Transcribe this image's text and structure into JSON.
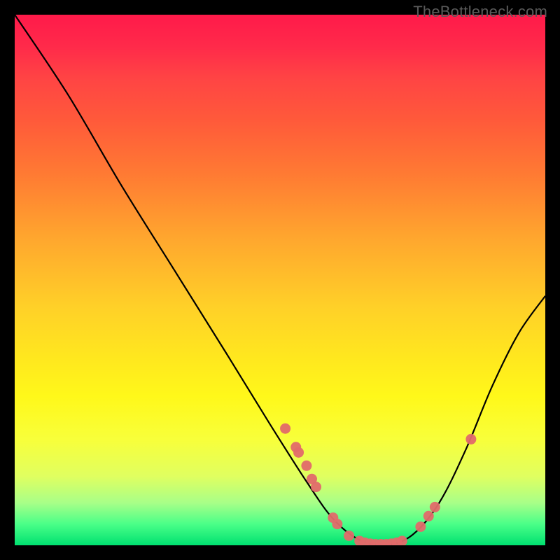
{
  "watermark": "TheBottleneck.com",
  "chart_data": {
    "type": "line",
    "title": "",
    "xlabel": "",
    "ylabel": "",
    "xlim": [
      0,
      100
    ],
    "ylim": [
      0,
      100
    ],
    "grid": false,
    "legend": false,
    "background_gradient": {
      "stops": [
        {
          "pos": 0,
          "color": "#ff1a4a"
        },
        {
          "pos": 50,
          "color": "#ffd028"
        },
        {
          "pos": 80,
          "color": "#f8ff3a"
        },
        {
          "pos": 100,
          "color": "#00e070"
        }
      ]
    },
    "curve": {
      "description": "V-shaped bottleneck curve descending to a basin then rising",
      "points_xy": [
        [
          0,
          100
        ],
        [
          10,
          85
        ],
        [
          20,
          68
        ],
        [
          30,
          52
        ],
        [
          40,
          36
        ],
        [
          48,
          23
        ],
        [
          55,
          12
        ],
        [
          60,
          5
        ],
        [
          65,
          1
        ],
        [
          70,
          0
        ],
        [
          75,
          2
        ],
        [
          80,
          8
        ],
        [
          85,
          18
        ],
        [
          90,
          30
        ],
        [
          95,
          40
        ],
        [
          100,
          47
        ]
      ]
    },
    "scatter_points": {
      "color": "#e16a6a",
      "points_xy": [
        [
          51,
          22
        ],
        [
          53,
          18.5
        ],
        [
          53.5,
          17.5
        ],
        [
          55,
          15
        ],
        [
          56,
          12.5
        ],
        [
          56.8,
          11
        ],
        [
          60,
          5.2
        ],
        [
          60.8,
          4
        ],
        [
          63,
          1.8
        ],
        [
          65,
          0.8
        ],
        [
          66,
          0.5
        ],
        [
          67,
          0.3
        ],
        [
          68,
          0.2
        ],
        [
          69,
          0.2
        ],
        [
          70,
          0.2
        ],
        [
          71,
          0.3
        ],
        [
          72,
          0.5
        ],
        [
          73,
          0.8
        ],
        [
          76.5,
          3.5
        ],
        [
          78,
          5.5
        ],
        [
          79.2,
          7.2
        ],
        [
          86,
          20
        ]
      ]
    }
  }
}
